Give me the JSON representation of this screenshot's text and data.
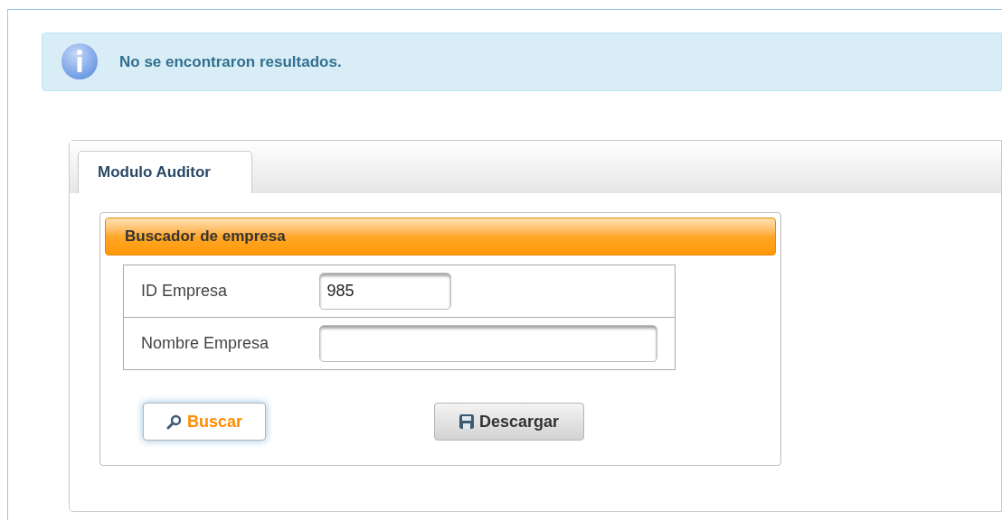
{
  "alert": {
    "kind": "info",
    "message": "No se encontraron resultados."
  },
  "tabs": [
    {
      "label": "Modulo Auditor",
      "selected": true
    }
  ],
  "panel": {
    "title": "Buscador de empresa",
    "fields": [
      {
        "label": "ID Empresa",
        "value": "985"
      },
      {
        "label": "Nombre Empresa"
      }
    ],
    "buttons": [
      {
        "label": "Buscar",
        "kind": "search",
        "focused": true
      },
      {
        "label": "Descargar",
        "kind": "download",
        "focused": false
      }
    ]
  }
}
